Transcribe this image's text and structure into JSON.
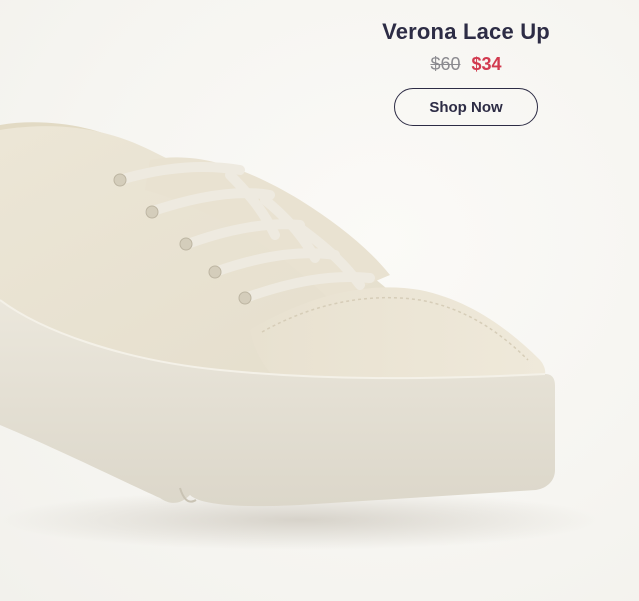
{
  "product": {
    "name": "Verona Lace Up",
    "price_original": "$60",
    "price_sale": "$34",
    "cta_label": "Shop Now",
    "image_icon": "canvas-platform-sneaker"
  },
  "colors": {
    "background": "#f7f6f2",
    "title": "#2d2c45",
    "sale_price": "#d23a4f",
    "original_price": "#8b8a8f",
    "button_border": "#2d2c45"
  }
}
